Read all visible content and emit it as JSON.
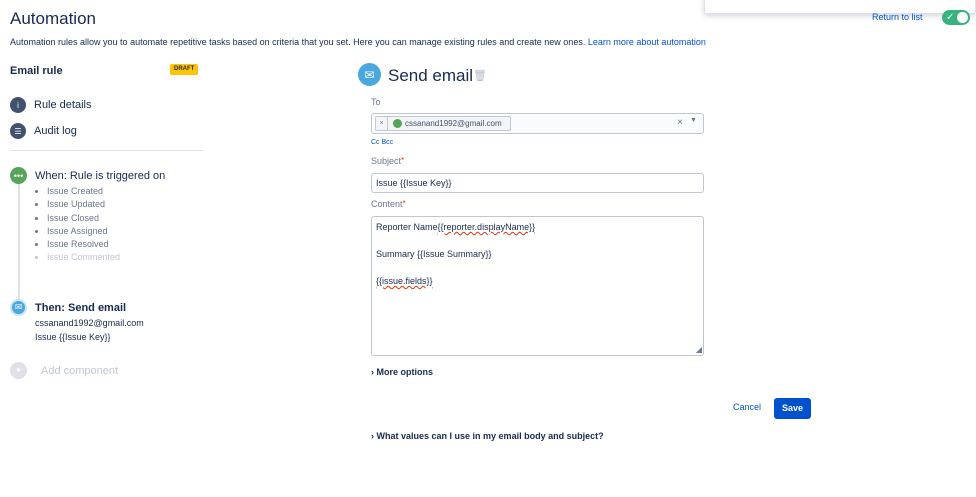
{
  "header": {
    "title": "Automation",
    "return_link": "Return to list",
    "toggle_check": "✓",
    "description": "Automation rules allow you to automate repetitive tasks based on criteria that you set. Here you can manage existing rules and create new ones. ",
    "learn_more": "Learn more about automation"
  },
  "sidebar": {
    "rule_name": "Email rule",
    "badge": "DRAFT",
    "links": [
      {
        "label": "Rule details",
        "icon": "info-icon"
      },
      {
        "label": "Audit log",
        "icon": "list-icon"
      }
    ],
    "trigger": {
      "title": "When: Rule is triggered on",
      "items": [
        "Issue Created",
        "Issue Updated",
        "Issue Closed",
        "Issue Assigned",
        "Issue Resolved",
        "Issue Commented"
      ]
    },
    "action": {
      "title": "Then: Send email",
      "email": "cssanand1992@gmail.com",
      "subject": "Issue {{Issue Key}}"
    },
    "add_component": "Add component"
  },
  "form": {
    "title": "Send email",
    "to_label": "To",
    "to_chips": [
      "cssanand1992@gmail.com"
    ],
    "to_clear": "×",
    "to_chip_remove": "×",
    "cc_bcc": "Cc Bcc",
    "subject_label": "Subject",
    "required_mark": "*",
    "subject_value": "Issue {{Issue Key}}",
    "content_label": "Content",
    "content": {
      "line1_prefix": "Reporter Name",
      "line1_var": "{{reporter.displayName}}",
      "line2": "Summary {{Issue Summary}}",
      "line3": "{{issue.fields}}"
    },
    "more_options": "More options",
    "cancel": "Cancel",
    "save": "Save",
    "help": "What values can I use in my email body and subject?"
  },
  "colors": {
    "primary": "#0052cc",
    "toggle_on": "#36b37e",
    "trigger_node": "#57a55a",
    "action_node": "#4aa7e0",
    "draft_badge": "#ffc400"
  }
}
